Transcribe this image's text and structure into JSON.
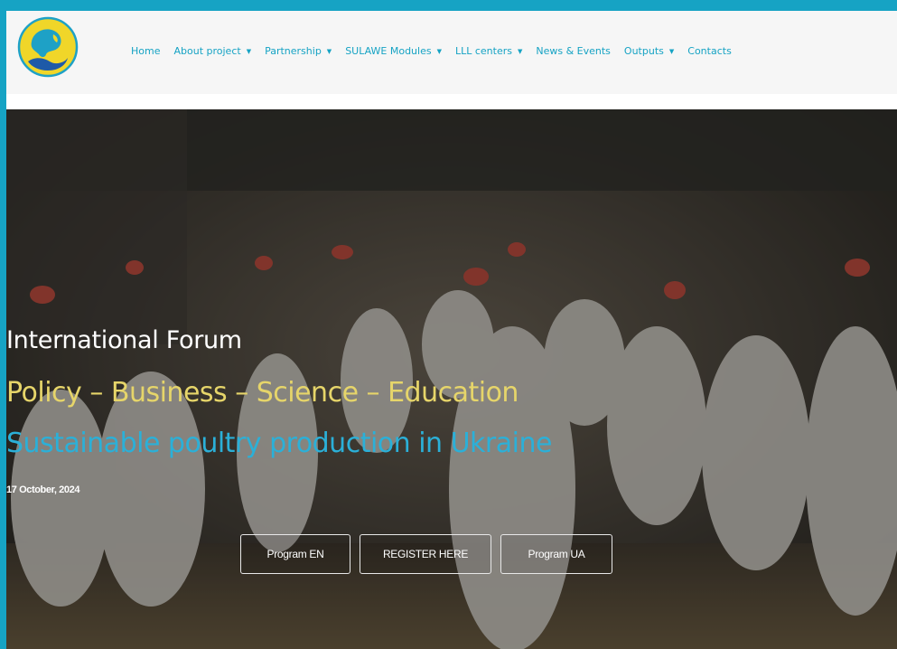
{
  "nav": {
    "items": [
      {
        "label": "Home",
        "dropdown": false
      },
      {
        "label": "About project",
        "dropdown": true
      },
      {
        "label": "Partnership",
        "dropdown": true
      },
      {
        "label": "SULAWE Modules",
        "dropdown": true
      },
      {
        "label": "LLL centers",
        "dropdown": true
      },
      {
        "label": "News & Events",
        "dropdown": false
      },
      {
        "label": "Outputs",
        "dropdown": true
      },
      {
        "label": "Contacts",
        "dropdown": false
      }
    ],
    "caret": "▼"
  },
  "hero": {
    "title": "International Forum",
    "subtitle": "Policy – Business – Science – Education",
    "tagline": "Sustainable poultry production in Ukraine",
    "date": "17 October, 2024",
    "buttons": {
      "program_en": "Program EN",
      "register": "REGISTER HERE",
      "program_ua": "Program UA"
    }
  },
  "colors": {
    "frame": "#16a3c4",
    "nav_text": "#16a3c4",
    "title": "#ffffff",
    "subtitle": "#e6d56a",
    "tagline": "#2bb0d8"
  },
  "icons": {
    "logo": "project-logo"
  }
}
